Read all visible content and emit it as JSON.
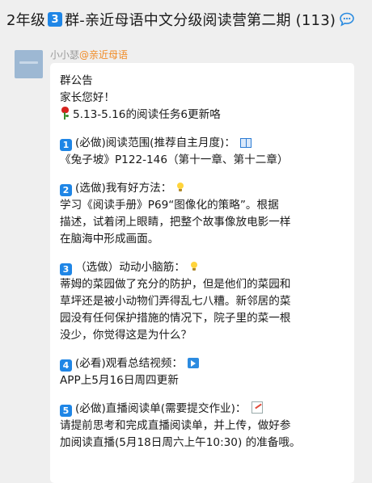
{
  "header": {
    "title_prefix": "2年级",
    "badge": "3",
    "title_suffix": "群-亲近母语中文分级阅读营第二期 (113)",
    "icon": "chat-bubble-icon"
  },
  "message": {
    "sender_name": "小小瑟",
    "sender_tag": "@亲近母语",
    "lines": [
      "群公告",
      "家长您好！",
      "5.13-5.16的阅读任务6更新咯"
    ],
    "items": [
      {
        "badge": "1",
        "head": "(必做)阅读范围(推荐自主月度)：",
        "icon": "book-icon",
        "body": [
          "《兔子坡》P122-146（第十一章、第十二章）"
        ]
      },
      {
        "badge": "2",
        "head": "(选做)我有好方法：",
        "icon": "lightbulb-icon",
        "body": [
          "学习《阅读手册》P69“图像化的策略”。根据",
          "描述，试着闭上眼睛，把整个故事像放电影一样",
          "在脑海中形成画面。"
        ]
      },
      {
        "badge": "3",
        "head": "（选做）动动小脑筋：",
        "icon": "lightbulb-icon",
        "body": [
          "蒂姆的菜园做了充分的防护，但是他们的菜园和",
          "草坪还是被小动物们弄得乱七八糟。新邻居的菜",
          "园没有任何保护措施的情况下，院子里的菜一根",
          "没少，你觉得这是为什么？"
        ]
      },
      {
        "badge": "4",
        "head": "(必看)观看总结视频：",
        "icon": "video-icon",
        "body": [
          "APP上5月16日周四更新"
        ]
      },
      {
        "badge": "5",
        "head": "(必做)直播阅读单(需要提交作业)：",
        "icon": "memo-icon",
        "body": [
          "请提前思考和完成直播阅读单，并上传，做好参",
          "加阅读直播(5月18日周六上午10:30) 的准备哦。"
        ]
      }
    ]
  },
  "colors": {
    "background": "#efefef",
    "bubble": "#ffffff",
    "badge": "#1f86e6",
    "sender_tag": "#f08a24"
  }
}
